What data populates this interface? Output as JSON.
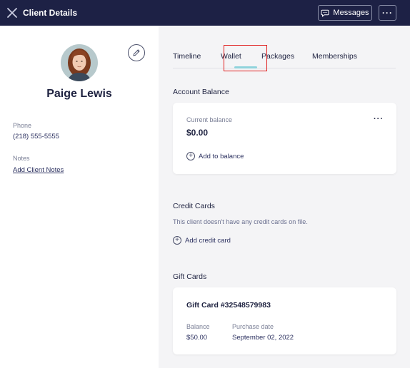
{
  "header": {
    "title": "Client Details",
    "messages_label": "Messages",
    "more_label": "···"
  },
  "client": {
    "name": "Paige Lewis",
    "phone_label": "Phone",
    "phone": "(218) 555-5555",
    "notes_label": "Notes",
    "add_notes": "Add Client Notes"
  },
  "tabs": [
    {
      "label": "Timeline",
      "active": false
    },
    {
      "label": "Wallet",
      "active": true
    },
    {
      "label": "Packages",
      "active": false
    },
    {
      "label": "Memberships",
      "active": false
    }
  ],
  "account_balance": {
    "title": "Account Balance",
    "current_label": "Current balance",
    "amount": "$0.00",
    "add_label": "Add to balance",
    "more_label": "···"
  },
  "credit_cards": {
    "title": "Credit Cards",
    "empty_text": "This client doesn't have any credit cards on file.",
    "add_label": "Add credit card"
  },
  "gift_cards": {
    "title": "Gift Cards",
    "card_title": "Gift Card #32548579983",
    "balance_label": "Balance",
    "balance": "$50.00",
    "purchase_label": "Purchase date",
    "purchase_date": "September 02, 2022"
  },
  "colors": {
    "header_bg": "#1d2145",
    "panel_bg": "#f4f4f6",
    "tab_accent": "#8fd3dc",
    "highlight": "#e02020"
  },
  "icons": [
    "close-icon",
    "chat-bubble-icon",
    "more-icon",
    "pencil-icon",
    "plus-circle-icon"
  ]
}
